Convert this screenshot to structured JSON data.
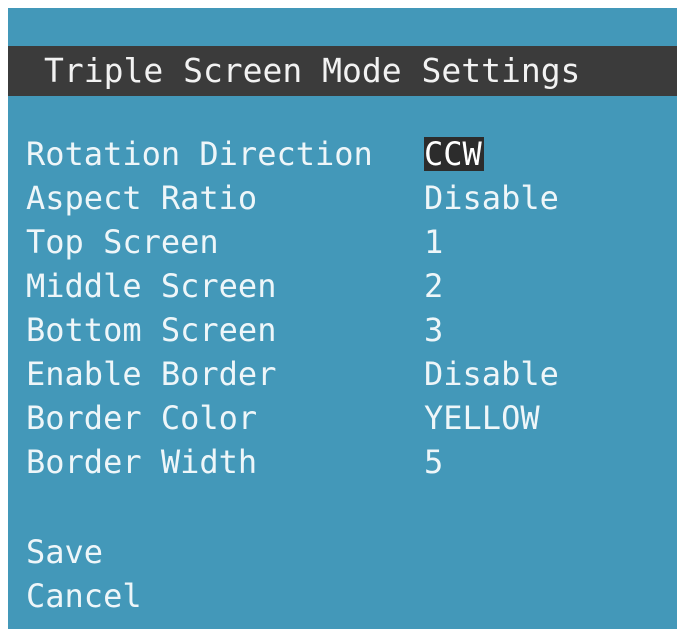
{
  "menu": {
    "title": "Triple Screen Mode Settings",
    "settings": [
      {
        "label": "Rotation Direction",
        "value": "CCW",
        "selected": true
      },
      {
        "label": "Aspect Ratio",
        "value": "Disable"
      },
      {
        "label": "Top Screen",
        "value": "1"
      },
      {
        "label": "Middle Screen",
        "value": "2"
      },
      {
        "label": "Bottom Screen",
        "value": "3"
      },
      {
        "label": "Enable Border",
        "value": "Disable"
      },
      {
        "label": "Border Color",
        "value": "YELLOW"
      },
      {
        "label": "Border Width",
        "value": "5"
      }
    ],
    "actions": {
      "save": "Save",
      "cancel": "Cancel"
    }
  },
  "colors": {
    "background": "#4398b9",
    "title_bar": "#3b3b3b",
    "selection_highlight": "#2c2c2c",
    "text": "#eef6f9"
  }
}
